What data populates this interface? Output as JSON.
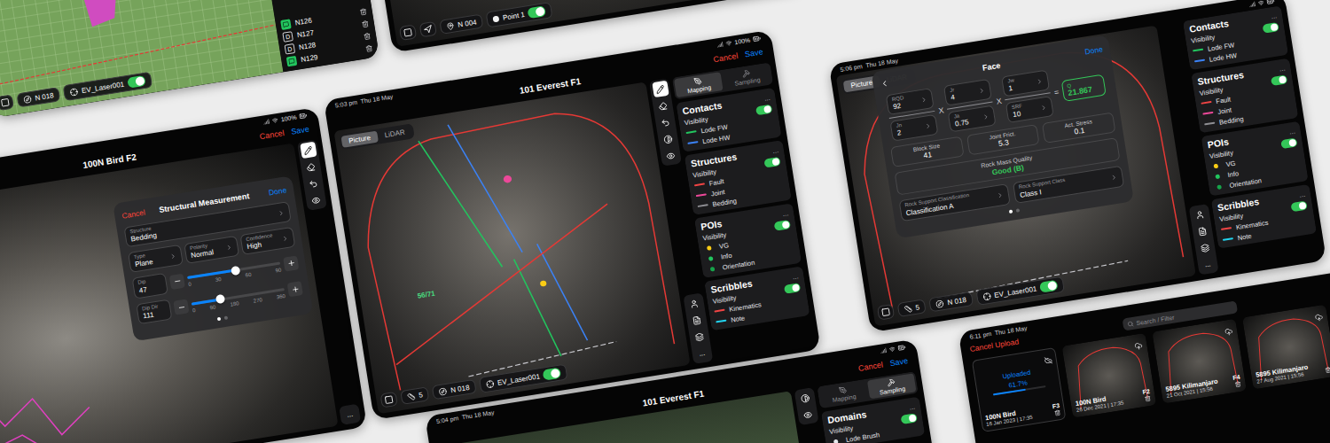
{
  "map_card": {
    "list": [
      {
        "label": "N126",
        "kind": "note"
      },
      {
        "label": "N127",
        "kind": "doc",
        "badge": "D"
      },
      {
        "label": "N128",
        "kind": "doc",
        "badge": "D"
      },
      {
        "label": "N129",
        "kind": "note"
      }
    ],
    "bottom_bar": {
      "direction": "N 018",
      "layer": "EV_Laser001",
      "layer_on": true
    }
  },
  "points_card": {
    "bottom_bar": {
      "direction": "N 004",
      "point": "Point 1",
      "point_on": true
    }
  },
  "measure_card": {
    "status": {
      "battery": "100%"
    },
    "title": "100N Bird F2",
    "actions": {
      "cancel": "Cancel",
      "save": "Save"
    },
    "tools": [
      {
        "selected": true
      },
      {
        "selected": false
      },
      {
        "selected": false
      },
      {
        "selected": false
      }
    ],
    "more": "...",
    "dialog": {
      "cancel": "Cancel",
      "title": "Structural Measurement",
      "done": "Done",
      "structure": {
        "label": "Structure",
        "value": "Bedding"
      },
      "selects": [
        {
          "label": "Type",
          "value": "Plane"
        },
        {
          "label": "Polarity",
          "value": "Normal"
        },
        {
          "label": "Confidence",
          "value": "High"
        }
      ],
      "sliders": [
        {
          "label": "Dip",
          "value": "47",
          "level": 0.522,
          "ticks": [
            "0",
            "30",
            "60",
            "90"
          ]
        },
        {
          "label": "Dip Dir",
          "value": "111",
          "level": 0.308,
          "ticks": [
            "0",
            "90",
            "180",
            "270",
            "360"
          ]
        }
      ],
      "pages": [
        {
          "selected": true
        },
        {
          "selected": false
        }
      ]
    }
  },
  "mapping_card": {
    "status": {
      "time": "5:03 pm  Thu 18 May",
      "battery": "100%"
    },
    "title": "101 Everest F1",
    "actions": {
      "cancel": "Cancel",
      "save": "Save"
    },
    "view_tabs": [
      {
        "label": "Picture",
        "selected": true
      },
      {
        "label": "LiDAR",
        "selected": false
      }
    ],
    "annotation": "56/71",
    "tools": [
      {
        "selected": true
      },
      {
        "selected": false
      },
      {
        "selected": false
      },
      {
        "selected": false
      },
      {
        "selected": false
      }
    ],
    "more": "...",
    "sidebar": {
      "tabs": [
        {
          "label": "Mapping",
          "selected": true
        },
        {
          "label": "Sampling",
          "selected": false
        }
      ],
      "sections": [
        {
          "title": "Contacts",
          "more": "...",
          "visibility_label": "Visibility",
          "visible": true,
          "items": [
            {
              "label": "Lode FW",
              "kind": "line",
              "color": "#22c55e"
            },
            {
              "label": "Lode HW",
              "kind": "line",
              "color": "#3b82f6"
            }
          ]
        },
        {
          "title": "Structures",
          "more": "...",
          "visibility_label": "Visibility",
          "visible": true,
          "items": [
            {
              "label": "Fault",
              "kind": "line",
              "color": "#ef4444"
            },
            {
              "label": "Joint",
              "kind": "line",
              "color": "#ec4899"
            },
            {
              "label": "Bedding",
              "kind": "line",
              "color": "#8e8e93"
            }
          ]
        },
        {
          "title": "POIs",
          "more": "...",
          "visibility_label": "Visibility",
          "visible": true,
          "items": [
            {
              "label": "VG",
              "kind": "dot",
              "color": "#facc15"
            },
            {
              "label": "Info",
              "kind": "dot",
              "color": "#22c55e"
            },
            {
              "label": "Orientation",
              "kind": "dot",
              "color": "#16a34a"
            }
          ]
        },
        {
          "title": "Scribbles",
          "more": "...",
          "visibility_label": "Visibility",
          "visible": true,
          "items": [
            {
              "label": "Kinematics",
              "kind": "line",
              "color": "#ef4444"
            },
            {
              "label": "Note",
              "kind": "line",
              "color": "#22d3ee"
            }
          ]
        }
      ]
    },
    "bottom_bar": {
      "scale": "5",
      "direction": "N 018",
      "layer": "EV_Laser001",
      "layer_on": true
    }
  },
  "face_card": {
    "status": {
      "time": "5:06 pm  Thu 18 May"
    },
    "view_tabs": [
      {
        "label": "Picture",
        "selected": true
      },
      {
        "label": "LiDAR",
        "selected": false
      }
    ],
    "more": "...",
    "dialog": {
      "title": "Face",
      "done": "Done",
      "fractions": [
        {
          "top": {
            "label": "RQD",
            "value": "92"
          },
          "bottom": {
            "label": "Jn",
            "value": "2"
          }
        },
        {
          "top": {
            "label": "Jr",
            "value": "4"
          },
          "bottom": {
            "label": "Ja",
            "value": "0.75"
          }
        },
        {
          "top": {
            "label": "Jw",
            "value": "1"
          },
          "bottom": {
            "label": "SRF",
            "value": "10"
          }
        }
      ],
      "operators": [
        "X",
        "X",
        "="
      ],
      "q": {
        "label": "Q",
        "value": "21.867"
      },
      "results": [
        {
          "label": "Block Size",
          "value": "41"
        },
        {
          "label": "Joint Frict.",
          "value": "5.3"
        },
        {
          "label": "Act. Stress",
          "value": "0.1"
        }
      ],
      "quality": {
        "label": "Rock Mass Quality",
        "value": "Good (B)"
      },
      "support": [
        {
          "label": "Rock Support Classification",
          "value": "Classification A"
        },
        {
          "label": "Rock Support Class",
          "value": "Class I"
        }
      ],
      "pages": [
        {
          "selected": true
        },
        {
          "selected": false
        }
      ]
    },
    "sidebar": {
      "sections": [
        {
          "title": "Contacts",
          "more": "...",
          "visibility_label": "Visibility",
          "visible": true,
          "items": [
            {
              "label": "Lode FW",
              "kind": "line",
              "color": "#22c55e"
            },
            {
              "label": "Lode HW",
              "kind": "line",
              "color": "#3b82f6"
            }
          ]
        },
        {
          "title": "Structures",
          "more": "...",
          "visibility_label": "Visibility",
          "visible": true,
          "items": [
            {
              "label": "Fault",
              "kind": "line",
              "color": "#ef4444"
            },
            {
              "label": "Joint",
              "kind": "line",
              "color": "#ec4899"
            },
            {
              "label": "Bedding",
              "kind": "line",
              "color": "#8e8e93"
            }
          ]
        },
        {
          "title": "POIs",
          "more": "...",
          "visibility_label": "Visibility",
          "visible": true,
          "items": [
            {
              "label": "VG",
              "kind": "dot",
              "color": "#facc15"
            },
            {
              "label": "Info",
              "kind": "dot",
              "color": "#22c55e"
            },
            {
              "label": "Orientation",
              "kind": "dot",
              "color": "#16a34a"
            }
          ]
        },
        {
          "title": "Scribbles",
          "more": "...",
          "visibility_label": "Visibility",
          "visible": true,
          "items": [
            {
              "label": "Kinematics",
              "kind": "line",
              "color": "#ef4444"
            },
            {
              "label": "Note",
              "kind": "line",
              "color": "#22d3ee"
            }
          ]
        }
      ]
    },
    "bottom_bar": {
      "scale": "5",
      "direction": "N 018",
      "layer": "EV_Laser001",
      "layer_on": true
    }
  },
  "domains_card": {
    "status": {
      "time": "5:04 pm  Thu 18 May"
    },
    "title": "101 Everest F1",
    "actions": {
      "cancel": "Cancel",
      "save": "Save"
    },
    "tools": [
      {
        "selected": false
      },
      {
        "selected": false
      }
    ],
    "sidebar": {
      "tabs": [
        {
          "label": "Mapping",
          "selected": false
        },
        {
          "label": "Sampling",
          "selected": true
        }
      ],
      "sections": [
        {
          "title": "Domains",
          "more": "...",
          "visibility_label": "Visibility",
          "visible": true,
          "items": [
            {
              "label": "Lode Brush",
              "kind": "dot",
              "color": "#e5e7eb"
            }
          ]
        }
      ]
    }
  },
  "upload_card": {
    "status": {
      "time": "6:11 pm  Thu 18 May"
    },
    "cancel": "Cancel Upload",
    "search": {
      "placeholder": "Search / Filter"
    },
    "tiles": [
      {
        "kind": "uploading",
        "state": "Uploaded",
        "progress": "61.7%",
        "level": 0.617,
        "name": "100N Bird",
        "face": "F3",
        "date": "16 Jan 2023 | 17:35"
      },
      {
        "kind": "photo",
        "name": "100N Bird",
        "face": "F2",
        "date": "26 Dec 2021 | 17:35"
      },
      {
        "kind": "photo",
        "name": "5895 Kilimanjaro",
        "face": "F4",
        "date": "21 Oct 2021 | 15:56"
      },
      {
        "kind": "photo",
        "name": "5895 Kilimanjaro",
        "date": "27 Aug 2021 | 15:56"
      }
    ]
  }
}
